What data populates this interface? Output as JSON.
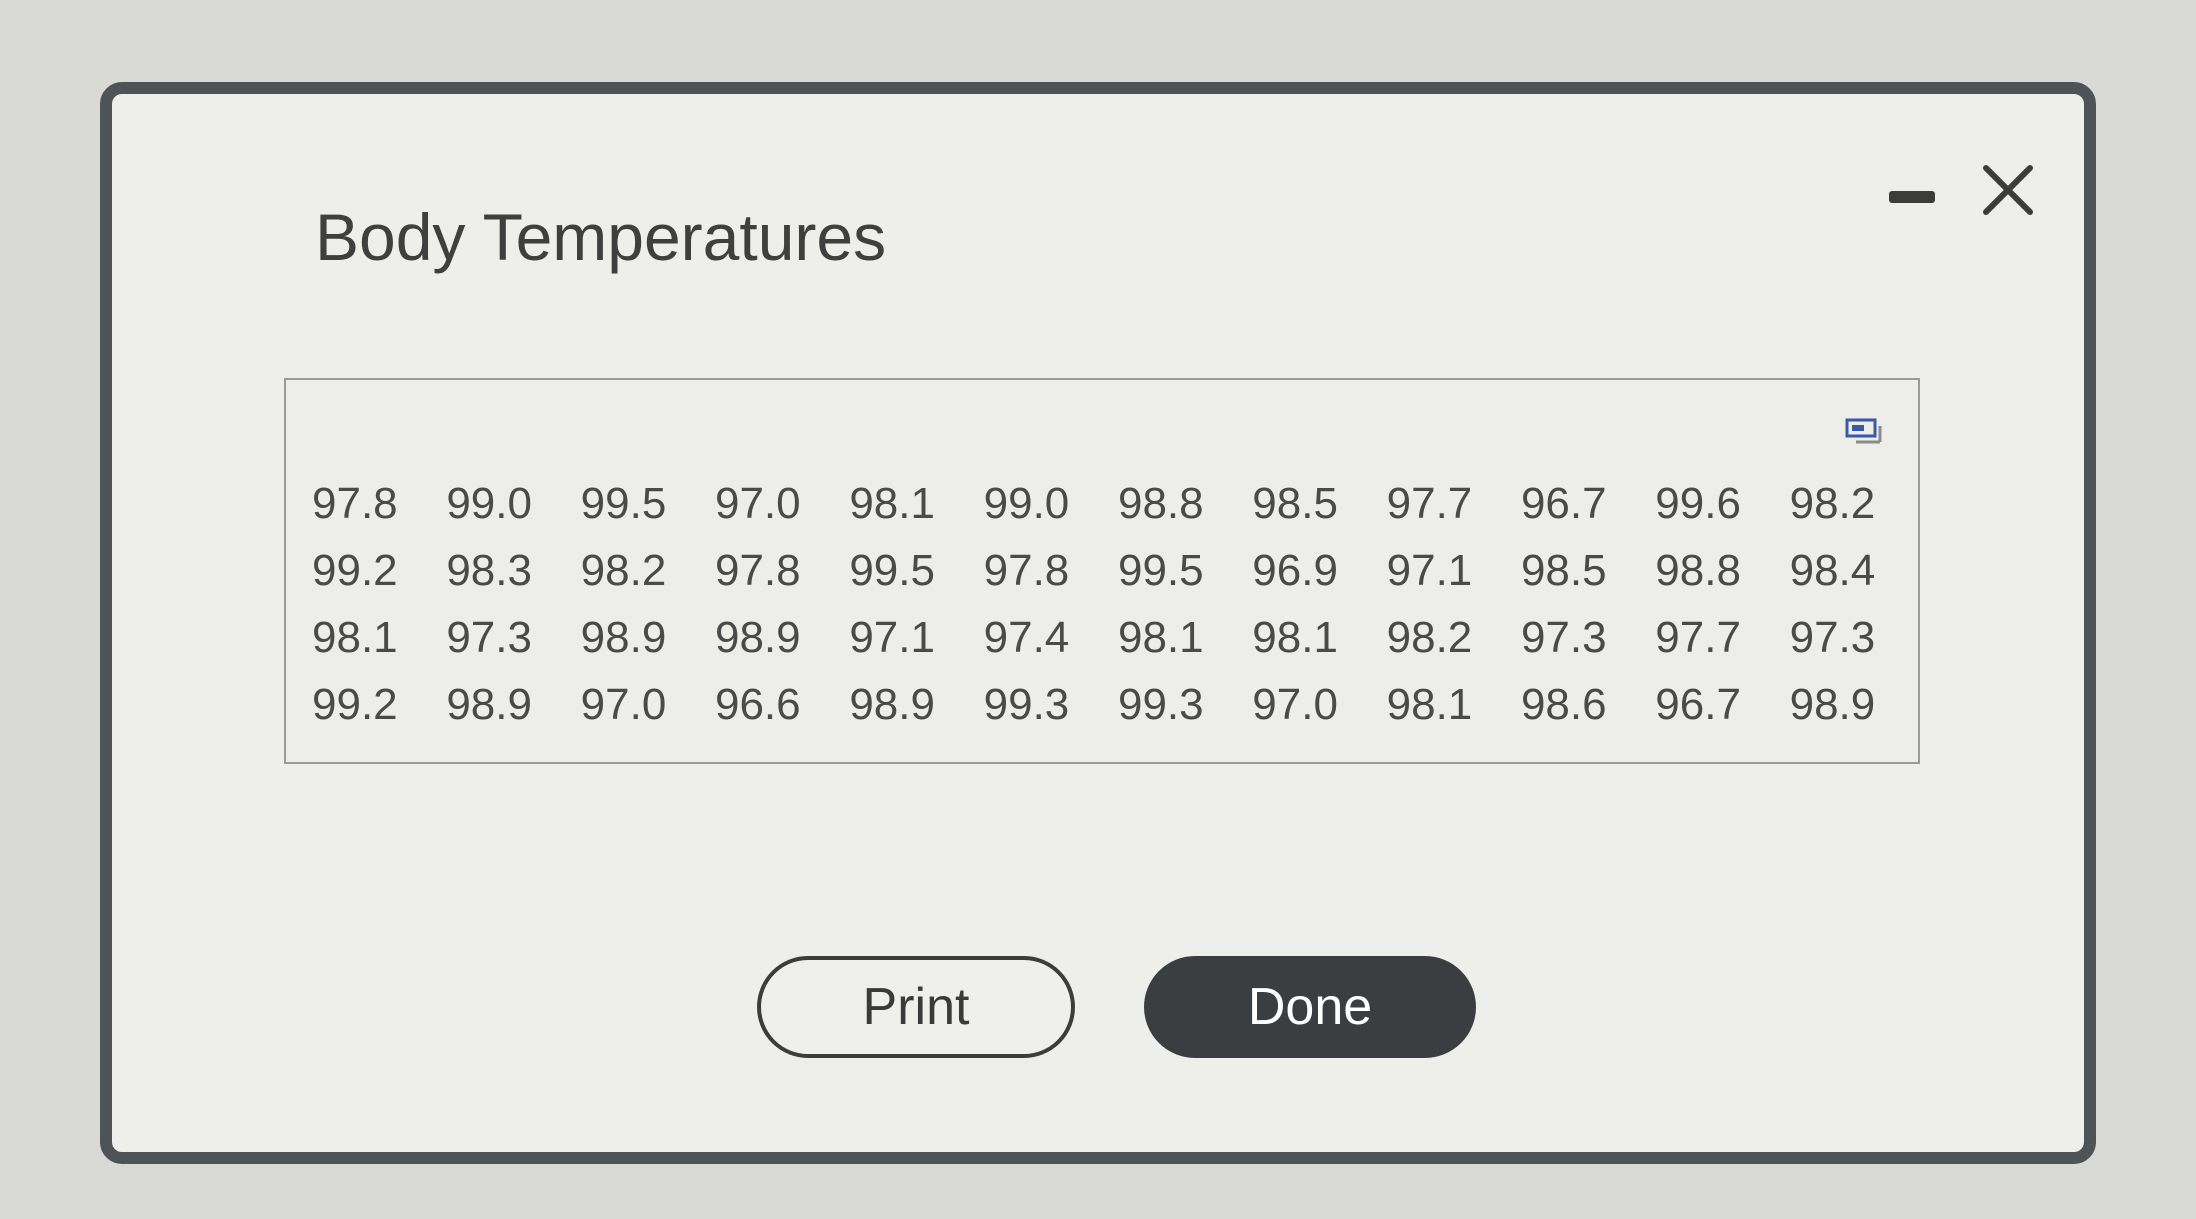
{
  "dialog": {
    "title": "Body Temperatures"
  },
  "table": {
    "rows": [
      [
        "97.8",
        "99.0",
        "99.5",
        "97.0",
        "98.1",
        "99.0",
        "98.8",
        "98.5",
        "97.7",
        "96.7",
        "99.6",
        "98.2"
      ],
      [
        "99.2",
        "98.3",
        "98.2",
        "97.8",
        "99.5",
        "97.8",
        "99.5",
        "96.9",
        "97.1",
        "98.5",
        "98.8",
        "98.4"
      ],
      [
        "98.1",
        "97.3",
        "98.9",
        "98.9",
        "97.1",
        "97.4",
        "98.1",
        "98.1",
        "98.2",
        "97.3",
        "97.7",
        "97.3"
      ],
      [
        "99.2",
        "98.9",
        "97.0",
        "96.6",
        "98.9",
        "99.3",
        "99.3",
        "97.0",
        "98.1",
        "98.6",
        "96.7",
        "98.9"
      ]
    ]
  },
  "buttons": {
    "print_label": "Print",
    "done_label": "Done"
  },
  "icons": {
    "minimize": "minimize-icon",
    "close": "close-icon",
    "expand": "expand-table-icon"
  },
  "colors": {
    "frame": "#4d5357",
    "background": "#eeeeeb",
    "done_button": "#3b3e41",
    "text": "#3f3f3f"
  }
}
